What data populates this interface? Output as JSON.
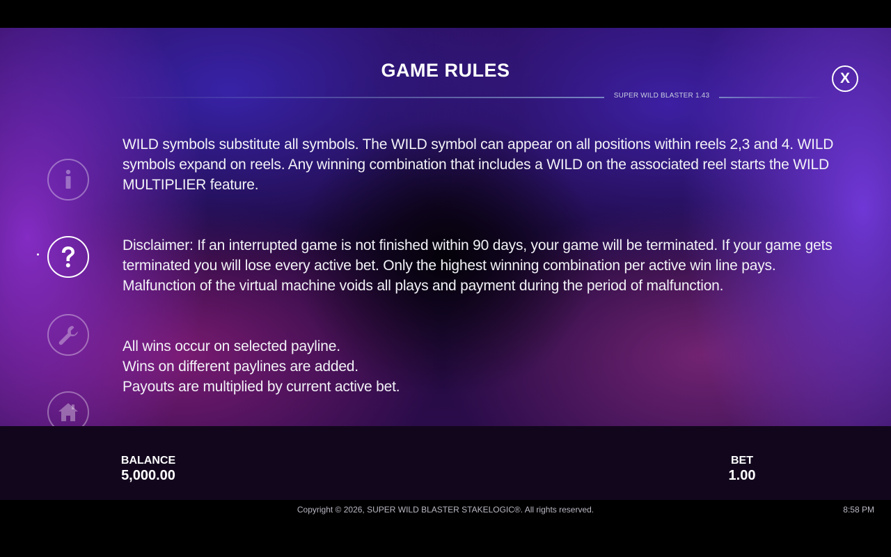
{
  "header": {
    "title": "GAME RULES",
    "version": "SUPER WILD BLASTER 1.43",
    "close_label": "X"
  },
  "nav": {
    "items": [
      {
        "name": "info",
        "icon": "info-icon",
        "active": false
      },
      {
        "name": "help",
        "icon": "question-icon",
        "active": true
      },
      {
        "name": "settings",
        "icon": "wrench-icon",
        "active": false
      },
      {
        "name": "home",
        "icon": "home-icon",
        "active": false
      }
    ]
  },
  "rules": {
    "wild_text": "WILD symbols substitute all symbols. The WILD symbol can appear on all positions within reels 2,3 and 4. WILD symbols expand on reels. Any winning combination that includes a WILD on the associated reel starts the WILD MULTIPLIER feature.",
    "disclaimer_text": "Disclaimer: If an interrupted game is not finished within 90 days, your game will be terminated. If your game gets terminated you will lose every active bet. Only the highest winning combination per active win line pays. Malfunction of the virtual machine voids all plays and payment during the period of malfunction.",
    "payline_lines": [
      "All wins occur on selected payline.",
      "Wins on different paylines are added.",
      "Payouts are multiplied by current active bet."
    ]
  },
  "bottom_bar": {
    "balance_label": "BALANCE",
    "balance_value": "5,000.00",
    "bet_label": "BET",
    "bet_value": "1.00"
  },
  "footer": {
    "copyright": "Copyright © 2026, SUPER WILD BLASTER STAKELOGIC®. All rights reserved.",
    "time": "8:58 PM"
  },
  "colors": {
    "background_purple": "#2a0d55",
    "bottom_bar": "#12061d",
    "text": "#ffffff"
  }
}
